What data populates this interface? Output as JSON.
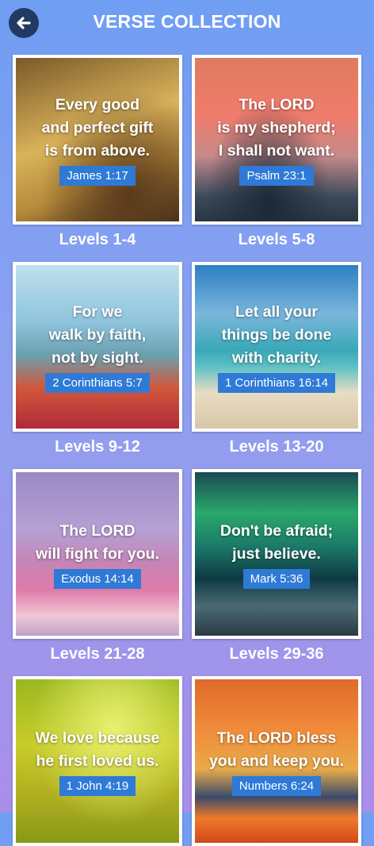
{
  "header": {
    "title": "VERSE COLLECTION",
    "back_icon": "back-arrow-icon"
  },
  "cards": [
    {
      "verse": "Every good\nand perfect gift\nis from above.",
      "reference": "James 1:17",
      "levels": "Levels 1-4"
    },
    {
      "verse": "The LORD\nis my shepherd;\nI shall not want.",
      "reference": "Psalm 23:1",
      "levels": "Levels 5-8"
    },
    {
      "verse": "For we\nwalk by faith,\nnot by sight.",
      "reference": "2 Corinthians 5:7",
      "levels": "Levels 9-12"
    },
    {
      "verse": "Let all your\nthings be done\nwith charity.",
      "reference": "1 Corinthians 16:14",
      "levels": "Levels 13-20"
    },
    {
      "verse": "The LORD\nwill fight for you.",
      "reference": "Exodus 14:14",
      "levels": "Levels 21-28"
    },
    {
      "verse": "Don't be afraid;\njust believe.",
      "reference": "Mark 5:36",
      "levels": "Levels 29-36"
    },
    {
      "verse": "We love because\nhe first loved us.",
      "reference": "1 John 4:19",
      "levels": ""
    },
    {
      "verse": "The LORD bless\nyou and keep you.",
      "reference": "Numbers 6:24",
      "levels": ""
    }
  ],
  "colors": {
    "reference_badge": "#2e7ad6",
    "back_button": "#203a63"
  }
}
